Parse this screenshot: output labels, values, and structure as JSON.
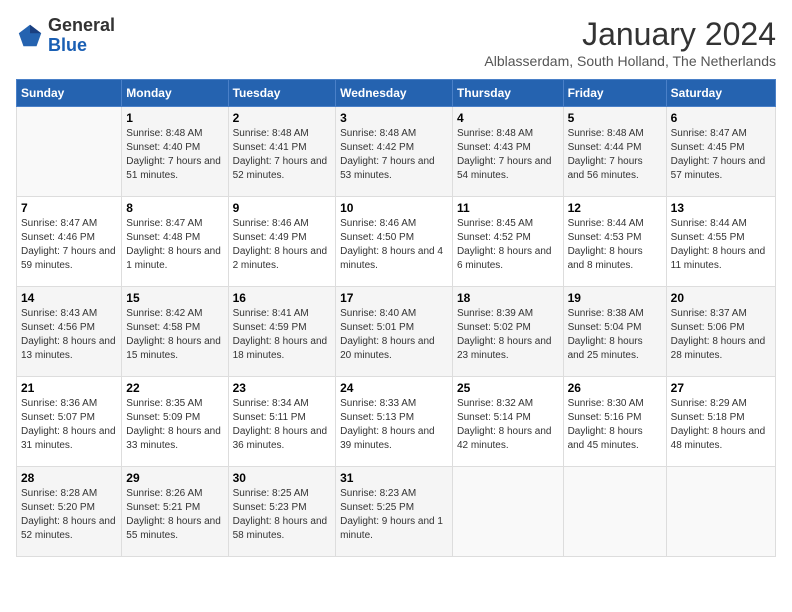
{
  "logo": {
    "general": "General",
    "blue": "Blue"
  },
  "header": {
    "month": "January 2024",
    "location": "Alblasserdam, South Holland, The Netherlands"
  },
  "weekdays": [
    "Sunday",
    "Monday",
    "Tuesday",
    "Wednesday",
    "Thursday",
    "Friday",
    "Saturday"
  ],
  "weeks": [
    [
      {
        "day": "",
        "sunrise": "",
        "sunset": "",
        "daylight": ""
      },
      {
        "day": "1",
        "sunrise": "Sunrise: 8:48 AM",
        "sunset": "Sunset: 4:40 PM",
        "daylight": "Daylight: 7 hours and 51 minutes."
      },
      {
        "day": "2",
        "sunrise": "Sunrise: 8:48 AM",
        "sunset": "Sunset: 4:41 PM",
        "daylight": "Daylight: 7 hours and 52 minutes."
      },
      {
        "day": "3",
        "sunrise": "Sunrise: 8:48 AM",
        "sunset": "Sunset: 4:42 PM",
        "daylight": "Daylight: 7 hours and 53 minutes."
      },
      {
        "day": "4",
        "sunrise": "Sunrise: 8:48 AM",
        "sunset": "Sunset: 4:43 PM",
        "daylight": "Daylight: 7 hours and 54 minutes."
      },
      {
        "day": "5",
        "sunrise": "Sunrise: 8:48 AM",
        "sunset": "Sunset: 4:44 PM",
        "daylight": "Daylight: 7 hours and 56 minutes."
      },
      {
        "day": "6",
        "sunrise": "Sunrise: 8:47 AM",
        "sunset": "Sunset: 4:45 PM",
        "daylight": "Daylight: 7 hours and 57 minutes."
      }
    ],
    [
      {
        "day": "7",
        "sunrise": "Sunrise: 8:47 AM",
        "sunset": "Sunset: 4:46 PM",
        "daylight": "Daylight: 7 hours and 59 minutes."
      },
      {
        "day": "8",
        "sunrise": "Sunrise: 8:47 AM",
        "sunset": "Sunset: 4:48 PM",
        "daylight": "Daylight: 8 hours and 1 minute."
      },
      {
        "day": "9",
        "sunrise": "Sunrise: 8:46 AM",
        "sunset": "Sunset: 4:49 PM",
        "daylight": "Daylight: 8 hours and 2 minutes."
      },
      {
        "day": "10",
        "sunrise": "Sunrise: 8:46 AM",
        "sunset": "Sunset: 4:50 PM",
        "daylight": "Daylight: 8 hours and 4 minutes."
      },
      {
        "day": "11",
        "sunrise": "Sunrise: 8:45 AM",
        "sunset": "Sunset: 4:52 PM",
        "daylight": "Daylight: 8 hours and 6 minutes."
      },
      {
        "day": "12",
        "sunrise": "Sunrise: 8:44 AM",
        "sunset": "Sunset: 4:53 PM",
        "daylight": "Daylight: 8 hours and 8 minutes."
      },
      {
        "day": "13",
        "sunrise": "Sunrise: 8:44 AM",
        "sunset": "Sunset: 4:55 PM",
        "daylight": "Daylight: 8 hours and 11 minutes."
      }
    ],
    [
      {
        "day": "14",
        "sunrise": "Sunrise: 8:43 AM",
        "sunset": "Sunset: 4:56 PM",
        "daylight": "Daylight: 8 hours and 13 minutes."
      },
      {
        "day": "15",
        "sunrise": "Sunrise: 8:42 AM",
        "sunset": "Sunset: 4:58 PM",
        "daylight": "Daylight: 8 hours and 15 minutes."
      },
      {
        "day": "16",
        "sunrise": "Sunrise: 8:41 AM",
        "sunset": "Sunset: 4:59 PM",
        "daylight": "Daylight: 8 hours and 18 minutes."
      },
      {
        "day": "17",
        "sunrise": "Sunrise: 8:40 AM",
        "sunset": "Sunset: 5:01 PM",
        "daylight": "Daylight: 8 hours and 20 minutes."
      },
      {
        "day": "18",
        "sunrise": "Sunrise: 8:39 AM",
        "sunset": "Sunset: 5:02 PM",
        "daylight": "Daylight: 8 hours and 23 minutes."
      },
      {
        "day": "19",
        "sunrise": "Sunrise: 8:38 AM",
        "sunset": "Sunset: 5:04 PM",
        "daylight": "Daylight: 8 hours and 25 minutes."
      },
      {
        "day": "20",
        "sunrise": "Sunrise: 8:37 AM",
        "sunset": "Sunset: 5:06 PM",
        "daylight": "Daylight: 8 hours and 28 minutes."
      }
    ],
    [
      {
        "day": "21",
        "sunrise": "Sunrise: 8:36 AM",
        "sunset": "Sunset: 5:07 PM",
        "daylight": "Daylight: 8 hours and 31 minutes."
      },
      {
        "day": "22",
        "sunrise": "Sunrise: 8:35 AM",
        "sunset": "Sunset: 5:09 PM",
        "daylight": "Daylight: 8 hours and 33 minutes."
      },
      {
        "day": "23",
        "sunrise": "Sunrise: 8:34 AM",
        "sunset": "Sunset: 5:11 PM",
        "daylight": "Daylight: 8 hours and 36 minutes."
      },
      {
        "day": "24",
        "sunrise": "Sunrise: 8:33 AM",
        "sunset": "Sunset: 5:13 PM",
        "daylight": "Daylight: 8 hours and 39 minutes."
      },
      {
        "day": "25",
        "sunrise": "Sunrise: 8:32 AM",
        "sunset": "Sunset: 5:14 PM",
        "daylight": "Daylight: 8 hours and 42 minutes."
      },
      {
        "day": "26",
        "sunrise": "Sunrise: 8:30 AM",
        "sunset": "Sunset: 5:16 PM",
        "daylight": "Daylight: 8 hours and 45 minutes."
      },
      {
        "day": "27",
        "sunrise": "Sunrise: 8:29 AM",
        "sunset": "Sunset: 5:18 PM",
        "daylight": "Daylight: 8 hours and 48 minutes."
      }
    ],
    [
      {
        "day": "28",
        "sunrise": "Sunrise: 8:28 AM",
        "sunset": "Sunset: 5:20 PM",
        "daylight": "Daylight: 8 hours and 52 minutes."
      },
      {
        "day": "29",
        "sunrise": "Sunrise: 8:26 AM",
        "sunset": "Sunset: 5:21 PM",
        "daylight": "Daylight: 8 hours and 55 minutes."
      },
      {
        "day": "30",
        "sunrise": "Sunrise: 8:25 AM",
        "sunset": "Sunset: 5:23 PM",
        "daylight": "Daylight: 8 hours and 58 minutes."
      },
      {
        "day": "31",
        "sunrise": "Sunrise: 8:23 AM",
        "sunset": "Sunset: 5:25 PM",
        "daylight": "Daylight: 9 hours and 1 minute."
      },
      {
        "day": "",
        "sunrise": "",
        "sunset": "",
        "daylight": ""
      },
      {
        "day": "",
        "sunrise": "",
        "sunset": "",
        "daylight": ""
      },
      {
        "day": "",
        "sunrise": "",
        "sunset": "",
        "daylight": ""
      }
    ]
  ]
}
